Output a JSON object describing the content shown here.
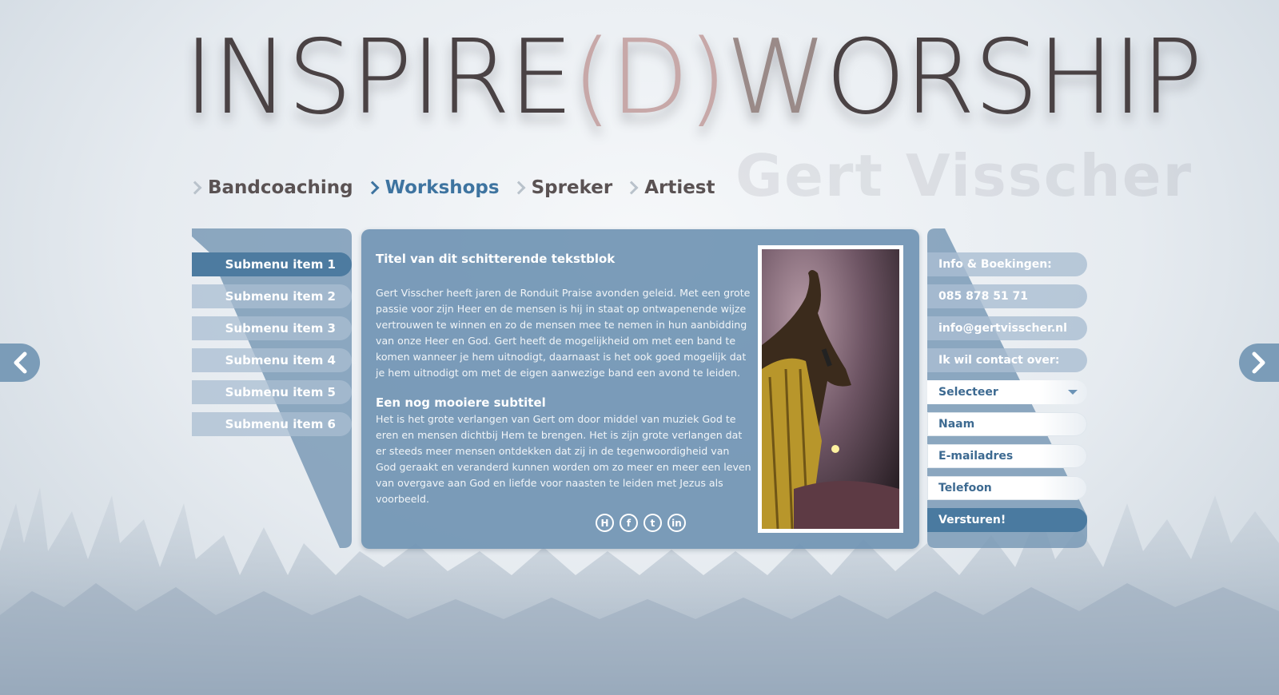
{
  "brand": {
    "logo_text_a": "INSPIRE",
    "logo_text_b": "(D)",
    "logo_text_c": "W",
    "logo_text_d": "ORSHIP",
    "tagline": "Gert Visscher"
  },
  "nav": {
    "items": [
      {
        "label": "Bandcoaching",
        "active": false
      },
      {
        "label": "Workshops",
        "active": true
      },
      {
        "label": "Spreker",
        "active": false
      },
      {
        "label": "Artiest",
        "active": false
      }
    ]
  },
  "submenu": {
    "items": [
      {
        "label": "Submenu item 1",
        "active": true
      },
      {
        "label": "Submenu item 2",
        "active": false
      },
      {
        "label": "Submenu item 3",
        "active": false
      },
      {
        "label": "Submenu item 4",
        "active": false
      },
      {
        "label": "Submenu item 5",
        "active": false
      },
      {
        "label": "Submenu item 6",
        "active": false
      }
    ]
  },
  "article": {
    "title": "Titel van dit schitterende tekstblok",
    "paragraph1": "Gert Visscher heeft jaren de Ronduit Praise avonden geleid. Met een grote passie voor zijn Heer en de mensen is hij in staat op ontwapenende wijze vertrouwen te winnen en zo de mensen mee te nemen in hun aanbidding van onze Heer en God. Gert heeft de mogelijkheid om met een band te komen wanneer je hem uitnodigt, daarnaast is het ook goed mogelijk dat je hem uitnodigt om met de eigen aanwezige band een avond te leiden.",
    "subtitle": "Een nog mooiere subtitel",
    "paragraph2": "Het is het grote verlangen van Gert om door middel van muziek God te eren en mensen dichtbij Hem te brengen. Het is zijn grote verlangen dat er steeds meer mensen ontdekken dat zij in de  tegenwoordigheid van God geraakt en veranderd kunnen worden om zo meer en meer een leven van overgave aan God en liefde voor naasten te leiden met Jezus als voorbeeld."
  },
  "social": {
    "icons": [
      {
        "name": "hyves-icon",
        "glyph": "H"
      },
      {
        "name": "facebook-icon",
        "glyph": "f"
      },
      {
        "name": "twitter-icon",
        "glyph": "t"
      },
      {
        "name": "linkedin-icon",
        "glyph": "in"
      }
    ]
  },
  "contact": {
    "heading": "Info & Boekingen:",
    "phone": "085 878 51 71",
    "email": "info@gertvisscher.nl",
    "subject_label": "Ik wil contact over:",
    "select_value": "Selecteer",
    "name_placeholder": "Naam",
    "email_placeholder": "E-mailadres",
    "phone_placeholder": "Telefoon",
    "submit_label": "Versturen!"
  },
  "colors": {
    "accent": "#3e74a0",
    "panel": "#7094b3",
    "nav_text": "#5a5253"
  }
}
